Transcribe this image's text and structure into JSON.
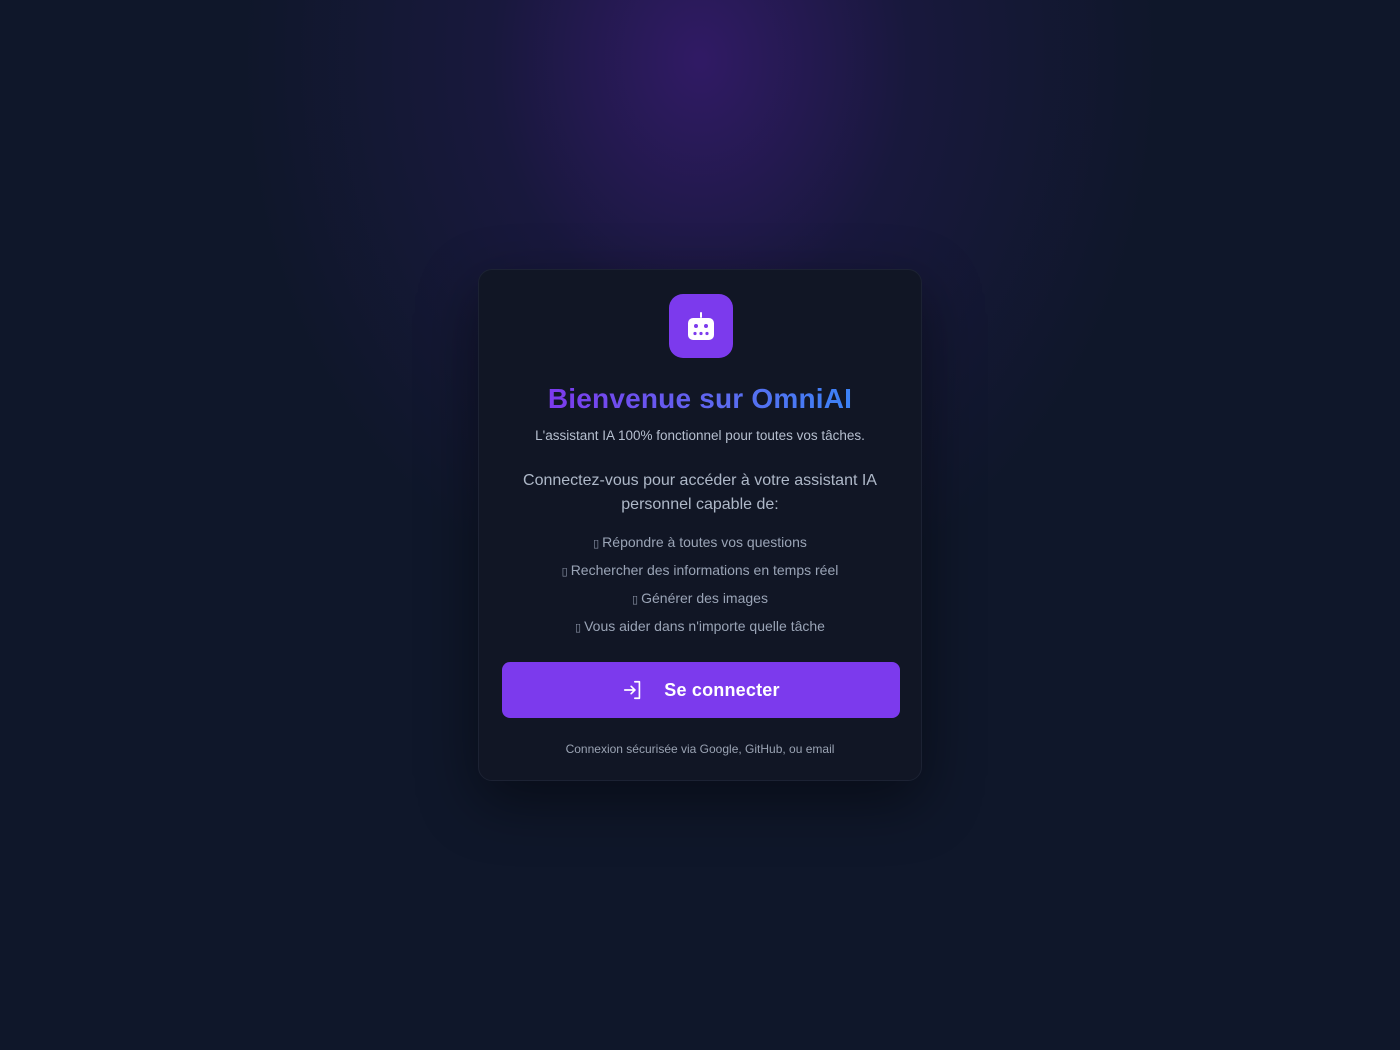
{
  "welcome": {
    "title": "Bienvenue sur OmniAI",
    "subtitle": "L'assistant IA 100% fonctionnel pour toutes vos tâches.",
    "intro": "Connectez-vous pour accéder à votre assistant IA personnel capable de:",
    "features": [
      {
        "bullet": "▯",
        "label": "Répondre à toutes vos questions"
      },
      {
        "bullet": "▯",
        "label": "Rechercher des informations en temps réel"
      },
      {
        "bullet": "▯",
        "label": "Générer des images"
      },
      {
        "bullet": "▯",
        "label": "Vous aider dans n'importe quelle tâche"
      }
    ],
    "login_button_label": "Se connecter",
    "login_button_icon": "sign-in-icon",
    "logo_icon": "robot-icon",
    "footnote": "Connexion sécurisée via Google, GitHub, ou email"
  },
  "colors": {
    "accent": "#7c3aed",
    "title_gradient_end": "#3b82f6",
    "background": "#0f172a",
    "card": "#111625"
  }
}
